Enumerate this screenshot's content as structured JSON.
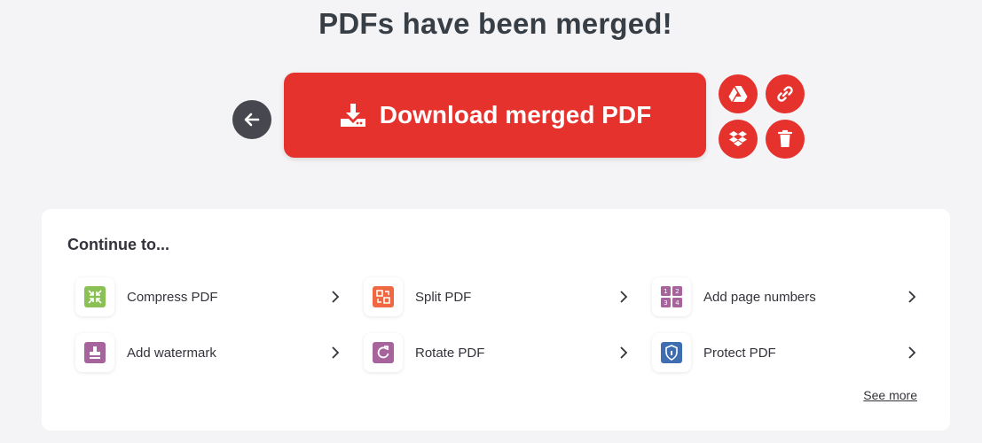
{
  "page_title": "PDFs have been merged!",
  "download": {
    "label": "Download merged PDF"
  },
  "continue": {
    "title": "Continue to...",
    "tools": [
      {
        "label": "Compress PDF",
        "icon": "compress-icon",
        "color": "#8ac054"
      },
      {
        "label": "Split PDF",
        "icon": "split-icon",
        "color": "#ef6842"
      },
      {
        "label": "Add page numbers",
        "icon": "page-numbers-icon",
        "color": "#a7649c"
      },
      {
        "label": "Add watermark",
        "icon": "watermark-icon",
        "color": "#a7649c"
      },
      {
        "label": "Rotate PDF",
        "icon": "rotate-icon",
        "color": "#a7649c"
      },
      {
        "label": "Protect PDF",
        "icon": "protect-icon",
        "color": "#3e6db0"
      }
    ],
    "see_more": "See more"
  },
  "colors": {
    "primary": "#e5322d",
    "back": "#47474f"
  }
}
